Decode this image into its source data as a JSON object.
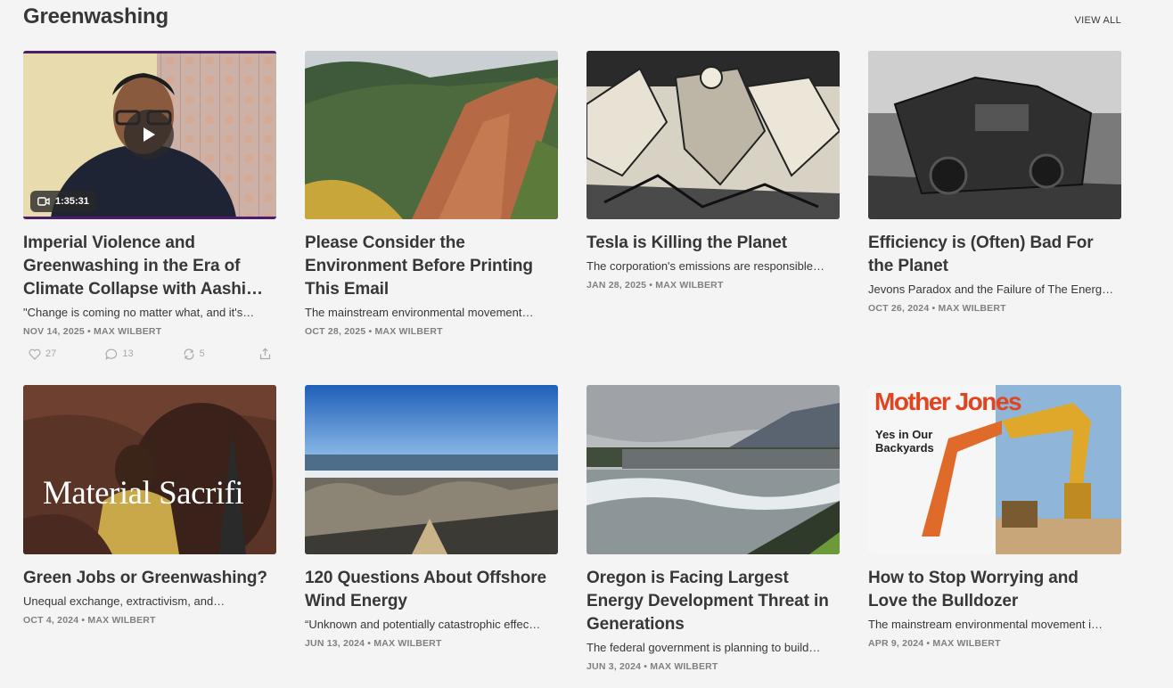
{
  "section": {
    "title": "Greenwashing",
    "view_all": "VIEW ALL"
  },
  "colors": {
    "background": "#f4f4f4",
    "text": "#363737",
    "meta": "#808080",
    "accent_video": "#4a1e6b"
  },
  "posts": [
    {
      "title": "Imperial Violence and Greenwashing in the Era of Climate Collapse with Aashi…",
      "subtitle": "\"Change is coming no matter what, and it's…",
      "meta": "NOV 14, 2025 • MAX WILBERT",
      "video_duration": "1:35:31",
      "likes": "27",
      "comments": "13",
      "restacks": "5"
    },
    {
      "title": "Please Consider the Environment Before Printing This Email",
      "subtitle": "The mainstream environmental movement…",
      "meta": "OCT 28, 2025 • MAX WILBERT"
    },
    {
      "title": "Tesla is Killing the Planet",
      "subtitle": "The corporation's emissions are responsible…",
      "meta": "JAN 28, 2025 • MAX WILBERT"
    },
    {
      "title": "Efficiency is (Often) Bad For the Planet",
      "subtitle": "Jevons Paradox and the Failure of The Energ…",
      "meta": "OCT 26, 2024 • MAX WILBERT"
    },
    {
      "title": "Green Jobs or Greenwashing?",
      "subtitle": "Unequal exchange, extractivism, and…",
      "meta": "OCT 4, 2024 • MAX WILBERT",
      "image_text": "Material Sacrifi"
    },
    {
      "title": "120 Questions About Offshore Wind Energy",
      "subtitle": "“Unknown and potentially catastrophic effec…",
      "meta": "JUN 13, 2024 • MAX WILBERT"
    },
    {
      "title": "Oregon is Facing Largest Energy Development Threat in Generations",
      "subtitle": "The federal government is planning to build…",
      "meta": "JUN 3, 2024 • MAX WILBERT"
    },
    {
      "title": "How to Stop Worrying and Love the Bulldozer",
      "subtitle": "The mainstream environmental movement i…",
      "meta": "APR 9, 2024 • MAX WILBERT",
      "image_brand": "Mother Jones",
      "image_headline": "Yes in Our Backyards"
    }
  ]
}
